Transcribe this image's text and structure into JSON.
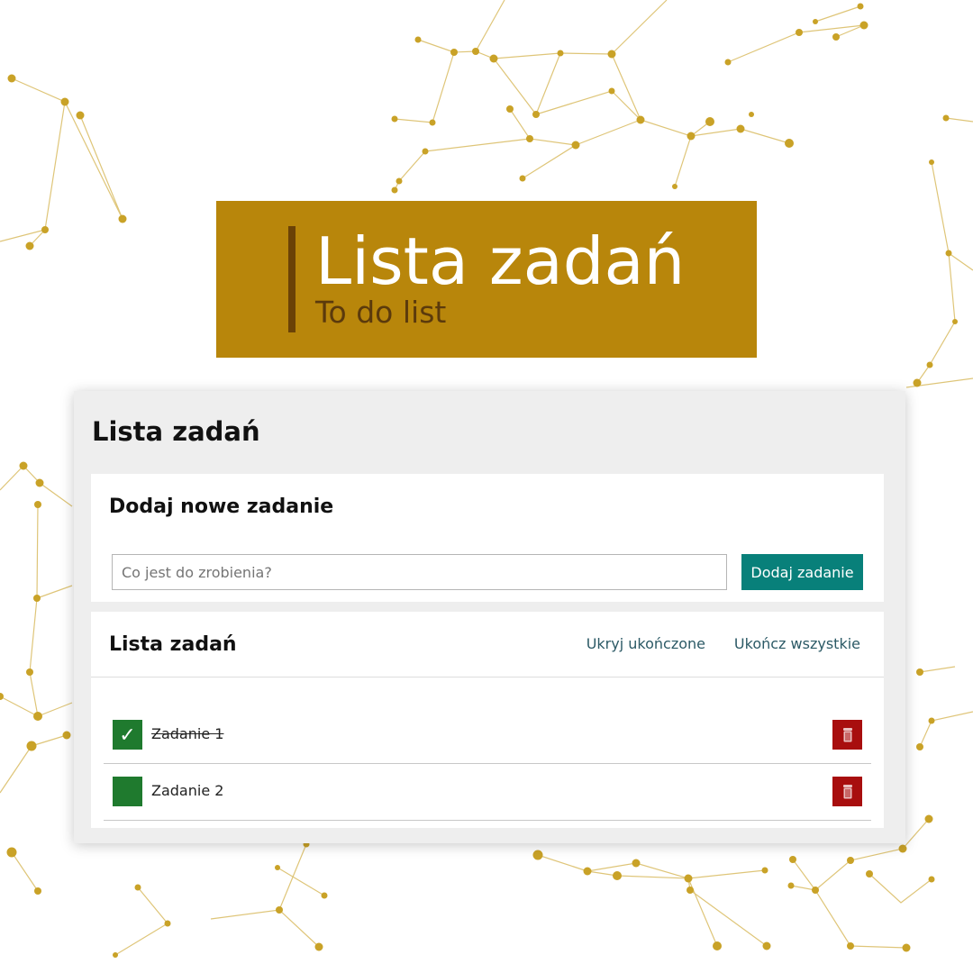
{
  "banner": {
    "title": "Lista zadań",
    "subtitle": "To do list"
  },
  "colors": {
    "banner_bg": "#b8860b",
    "banner_bar": "#6b4206",
    "accent_button": "#08807a",
    "checkbox": "#1f7a2e",
    "delete": "#a80e0e",
    "network": "#c9a227"
  },
  "app": {
    "title": "Lista zadań",
    "add_section": {
      "title": "Dodaj nowe zadanie",
      "input_placeholder": "Co jest do zrobienia?",
      "input_value": "",
      "add_button": "Dodaj zadanie"
    },
    "list_section": {
      "title": "Lista zadań",
      "hide_completed": "Ukryj ukończone",
      "complete_all": "Ukończ wszystkie",
      "tasks": [
        {
          "label": "Zadanie 1",
          "done": true,
          "check_glyph": "✓",
          "check_icon": "checkmark-icon",
          "delete_icon": "trash-icon"
        },
        {
          "label": "Zadanie 2",
          "done": false,
          "check_glyph": "",
          "check_icon": "checkbox-icon",
          "delete_icon": "trash-icon"
        }
      ]
    }
  }
}
